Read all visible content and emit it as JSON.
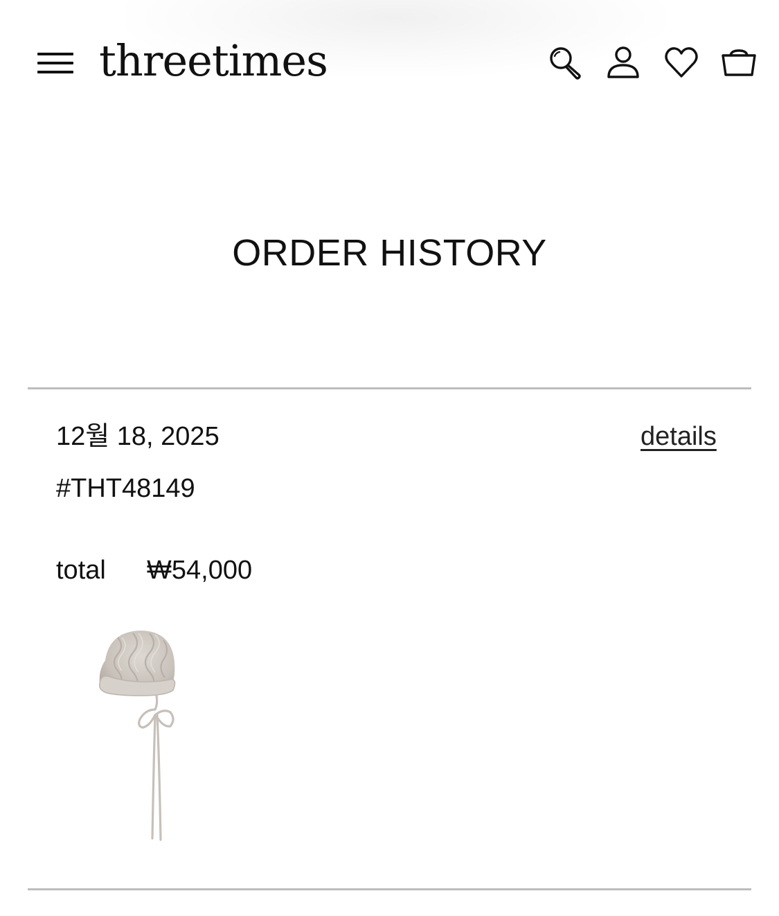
{
  "header": {
    "logo": "threetimes",
    "icons": [
      "menu-icon",
      "search-icon",
      "account-icon",
      "wishlist-heart-icon",
      "shopping-basket-icon"
    ]
  },
  "page": {
    "title": "ORDER HISTORY"
  },
  "orders": [
    {
      "date": "12월 18, 2025",
      "order_number": "#THT48149",
      "details_label": "details",
      "total_label": "total",
      "total_value": "₩54,000",
      "items": [
        {
          "image": "knit-bonnet-hat-image",
          "color": "#cfc8c1"
        }
      ]
    }
  ],
  "colors": {
    "text": "#111111",
    "divider": "#bdbdbd",
    "background": "#ffffff"
  }
}
